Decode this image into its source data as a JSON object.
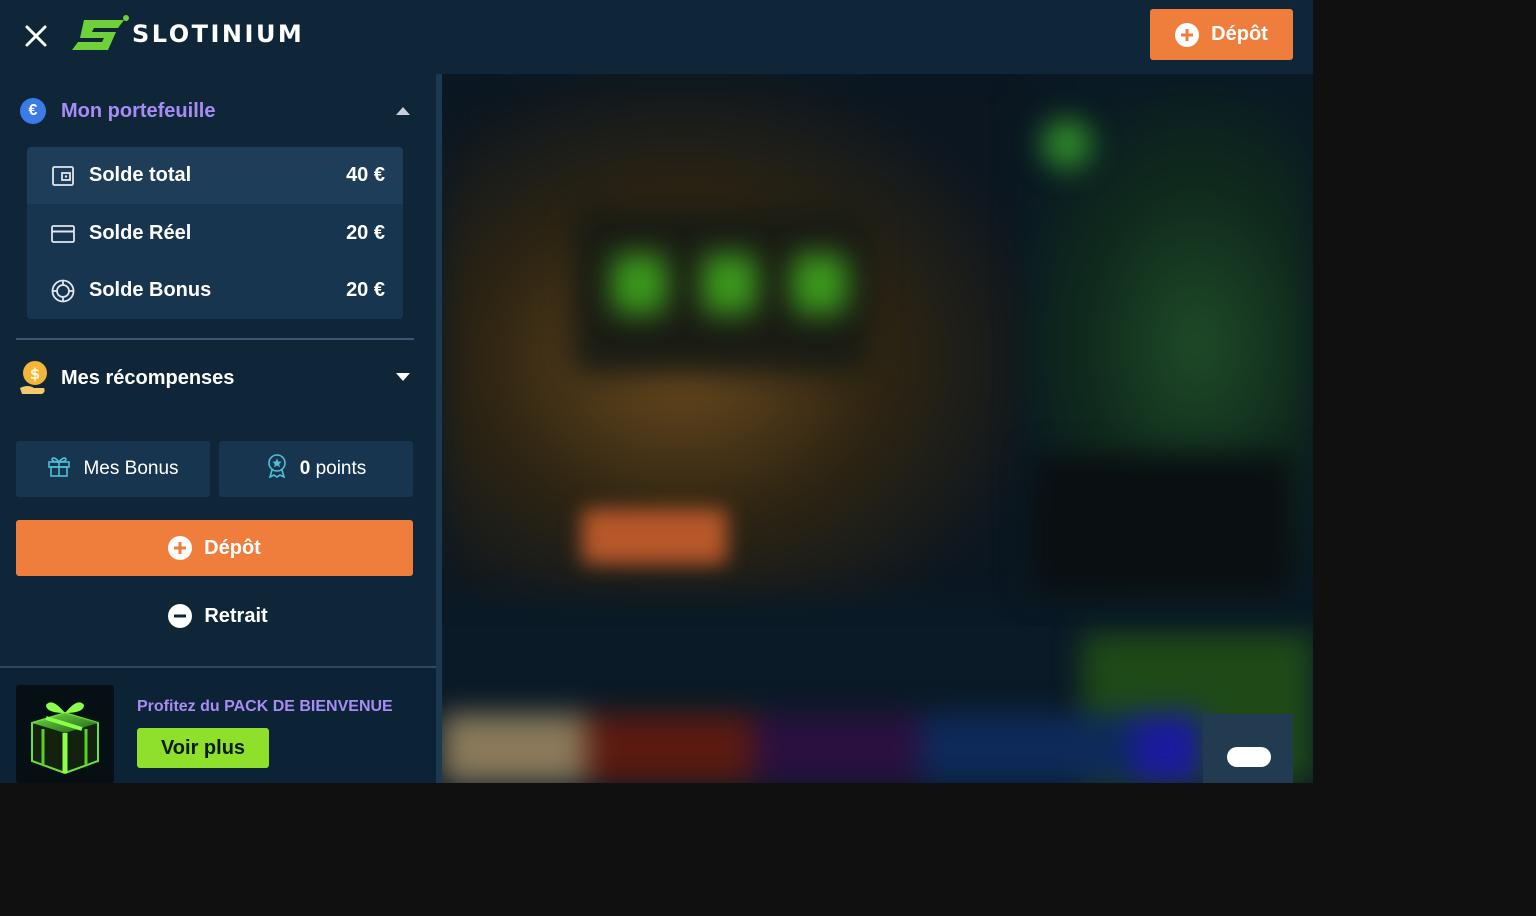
{
  "header": {
    "brand": "SLOTINIUM",
    "deposit_label": "Dépôt"
  },
  "sidebar": {
    "wallet": {
      "title": "Mon portefeuille",
      "currency_symbol": "€",
      "balances": [
        {
          "label": "Solde total",
          "value": "40 €",
          "icon": "wallet-icon"
        },
        {
          "label": "Solde Réel",
          "value": "20 €",
          "icon": "card-icon"
        },
        {
          "label": "Solde Bonus",
          "value": "20 €",
          "icon": "chip-icon"
        }
      ]
    },
    "rewards": {
      "title": "Mes récompenses",
      "bonus_label": "Mes Bonus",
      "points_value": "0",
      "points_unit": "points"
    },
    "deposit_label": "Dépôt",
    "withdraw_label": "Retrait",
    "promo": {
      "text_prefix": "Profitez du ",
      "text_highlight": "PACK DE BIENVENUE",
      "button_label": "Voir plus"
    }
  },
  "colors": {
    "accent_orange": "#ef7d3c",
    "accent_purple": "#a88cf5",
    "accent_green": "#8ee02a",
    "sidebar_bg": "#0f2638"
  }
}
